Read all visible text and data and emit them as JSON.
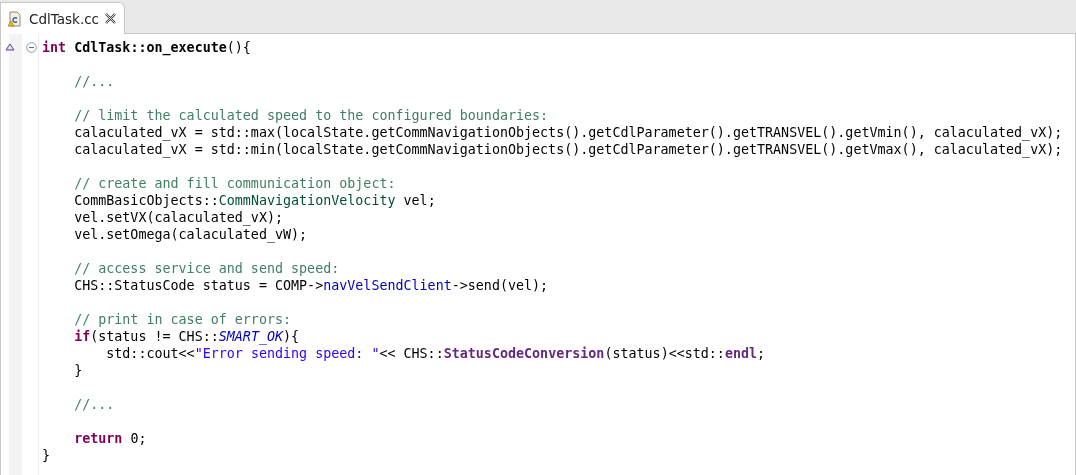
{
  "tabs": [
    {
      "label": "CdlTask.cc",
      "selected": true
    }
  ],
  "function": {
    "fold_expanded": true,
    "override_marker": true,
    "signature": [
      {
        "kind": "keyword",
        "text": "int"
      },
      {
        "kind": "name",
        "text": " CdlTask::on_execute"
      },
      {
        "kind": "plain",
        "text": "(){"
      }
    ],
    "body": [
      {
        "kind": "blank"
      },
      {
        "kind": "code",
        "tokens": [
          {
            "kind": "comment",
            "text": "    //..."
          }
        ]
      },
      {
        "kind": "blank"
      },
      {
        "kind": "code",
        "tokens": [
          {
            "kind": "comment",
            "text": "    // limit the calculated speed to the configured boundaries:"
          }
        ]
      },
      {
        "kind": "code",
        "tokens": [
          {
            "kind": "plain",
            "text": "    calaculated_vX = std::max(localState.getCommNavigationObjects().getCdlParameter().getTRANSVEL().getVmin(), calaculated_vX);"
          }
        ]
      },
      {
        "kind": "code",
        "tokens": [
          {
            "kind": "plain",
            "text": "    calaculated_vX = std::min(localState.getCommNavigationObjects().getCdlParameter().getTRANSVEL().getVmax(), calaculated_vX);"
          }
        ]
      },
      {
        "kind": "blank"
      },
      {
        "kind": "code",
        "tokens": [
          {
            "kind": "comment",
            "text": "    // create and fill communication object:"
          }
        ]
      },
      {
        "kind": "code",
        "tokens": [
          {
            "kind": "plain",
            "text": "    CommBasicObjects::"
          },
          {
            "kind": "type",
            "text": "CommNavigationVelocity"
          },
          {
            "kind": "plain",
            "text": " vel;"
          }
        ]
      },
      {
        "kind": "code",
        "tokens": [
          {
            "kind": "plain",
            "text": "    vel.setVX(calaculated_vX);"
          }
        ]
      },
      {
        "kind": "code",
        "tokens": [
          {
            "kind": "plain",
            "text": "    vel.setOmega(calaculated_vW);"
          }
        ]
      },
      {
        "kind": "blank"
      },
      {
        "kind": "code",
        "tokens": [
          {
            "kind": "comment",
            "text": "    // access service and send speed:"
          }
        ]
      },
      {
        "kind": "code",
        "tokens": [
          {
            "kind": "plain",
            "text": "    CHS::StatusCode status = COMP->"
          },
          {
            "kind": "field",
            "text": "navVelSendClient"
          },
          {
            "kind": "plain",
            "text": "->send(vel);"
          }
        ]
      },
      {
        "kind": "blank"
      },
      {
        "kind": "code",
        "tokens": [
          {
            "kind": "comment",
            "text": "    // print in case of errors:"
          }
        ]
      },
      {
        "kind": "code",
        "tokens": [
          {
            "kind": "keyword",
            "text": "    if"
          },
          {
            "kind": "plain",
            "text": "(status != CHS::"
          },
          {
            "kind": "enumerator",
            "text": "SMART_OK"
          },
          {
            "kind": "plain",
            "text": "){"
          }
        ]
      },
      {
        "kind": "code",
        "tokens": [
          {
            "kind": "plain",
            "text": "        std::cout<<"
          },
          {
            "kind": "string",
            "text": "\"Error sending speed: \""
          },
          {
            "kind": "plain",
            "text": "<< CHS::"
          },
          {
            "kind": "function",
            "text": "StatusCodeConversion"
          },
          {
            "kind": "plain",
            "text": "(status)<<std::"
          },
          {
            "kind": "function",
            "text": "endl"
          },
          {
            "kind": "plain",
            "text": ";"
          }
        ]
      },
      {
        "kind": "code",
        "tokens": [
          {
            "kind": "plain",
            "text": "    }"
          }
        ]
      },
      {
        "kind": "blank"
      },
      {
        "kind": "code",
        "tokens": [
          {
            "kind": "comment",
            "text": "    //..."
          }
        ]
      },
      {
        "kind": "blank"
      },
      {
        "kind": "code",
        "tokens": [
          {
            "kind": "keyword",
            "text": "    return"
          },
          {
            "kind": "plain",
            "text": " 0;"
          }
        ]
      },
      {
        "kind": "code",
        "tokens": [
          {
            "kind": "plain",
            "text": "}"
          }
        ]
      }
    ]
  }
}
